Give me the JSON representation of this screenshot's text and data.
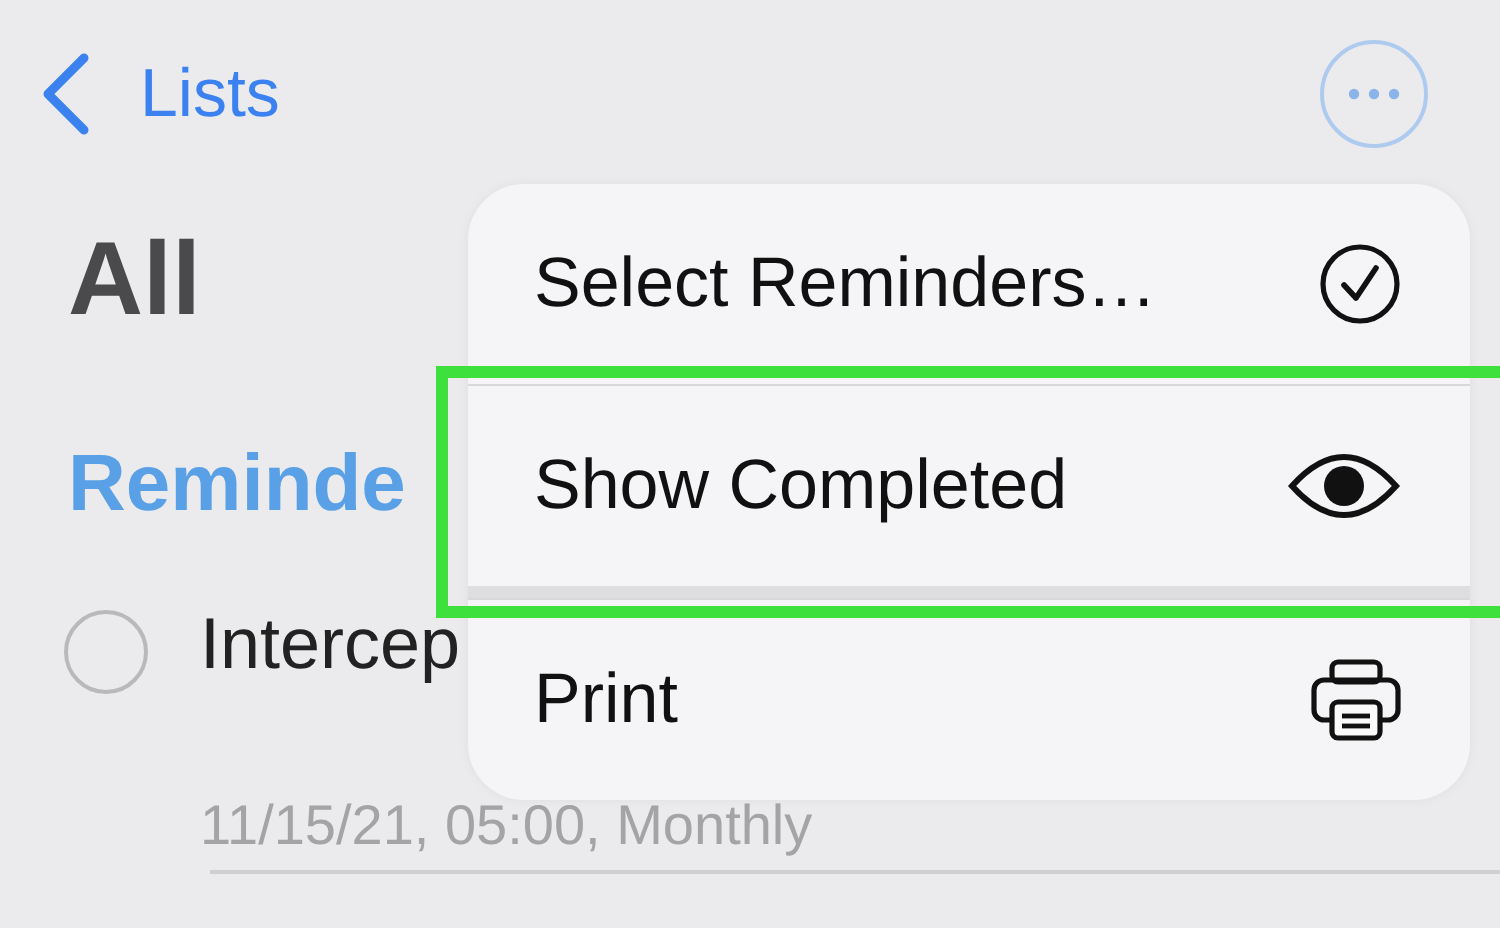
{
  "nav": {
    "back_label": "Lists"
  },
  "title": "All",
  "section": {
    "header": "Reminde"
  },
  "reminders": [
    {
      "title": "Intercep",
      "detail": "11/15/21, 05:00, Monthly",
      "completed": false
    }
  ],
  "menu": {
    "items": [
      {
        "label": "Select Reminders…",
        "kind": "check",
        "highlighted": false
      },
      {
        "label": "Show Completed",
        "kind": "eye",
        "highlighted": true
      },
      {
        "label": "Print",
        "kind": "printer",
        "highlighted": false
      }
    ]
  }
}
